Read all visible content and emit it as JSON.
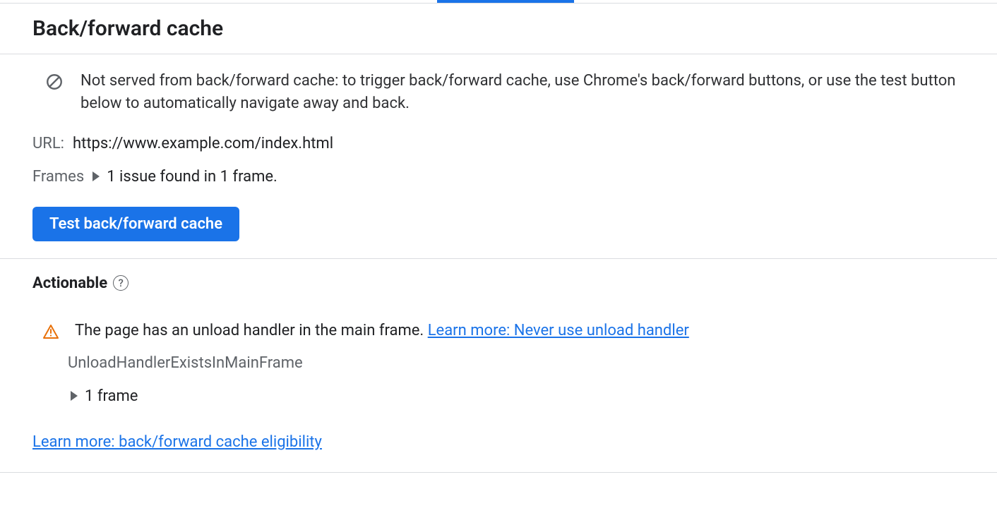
{
  "header": {
    "title": "Back/forward cache"
  },
  "status": {
    "message": "Not served from back/forward cache: to trigger back/forward cache, use Chrome's back/forward buttons, or use the test button below to automatically navigate away and back."
  },
  "url": {
    "label": "URL:",
    "value": "https://www.example.com/index.html"
  },
  "frames": {
    "label": "Frames",
    "summary": "1 issue found in 1 frame."
  },
  "buttons": {
    "test_label": "Test back/forward cache"
  },
  "actionable": {
    "heading": "Actionable",
    "issue_text": "The page has an unload handler in the main frame. ",
    "issue_link_text": "Learn more: Never use unload handler",
    "reason_code": "UnloadHandlerExistsInMainFrame",
    "frame_count_text": "1 frame"
  },
  "footer_link": {
    "text": "Learn more: back/forward cache eligibility"
  }
}
